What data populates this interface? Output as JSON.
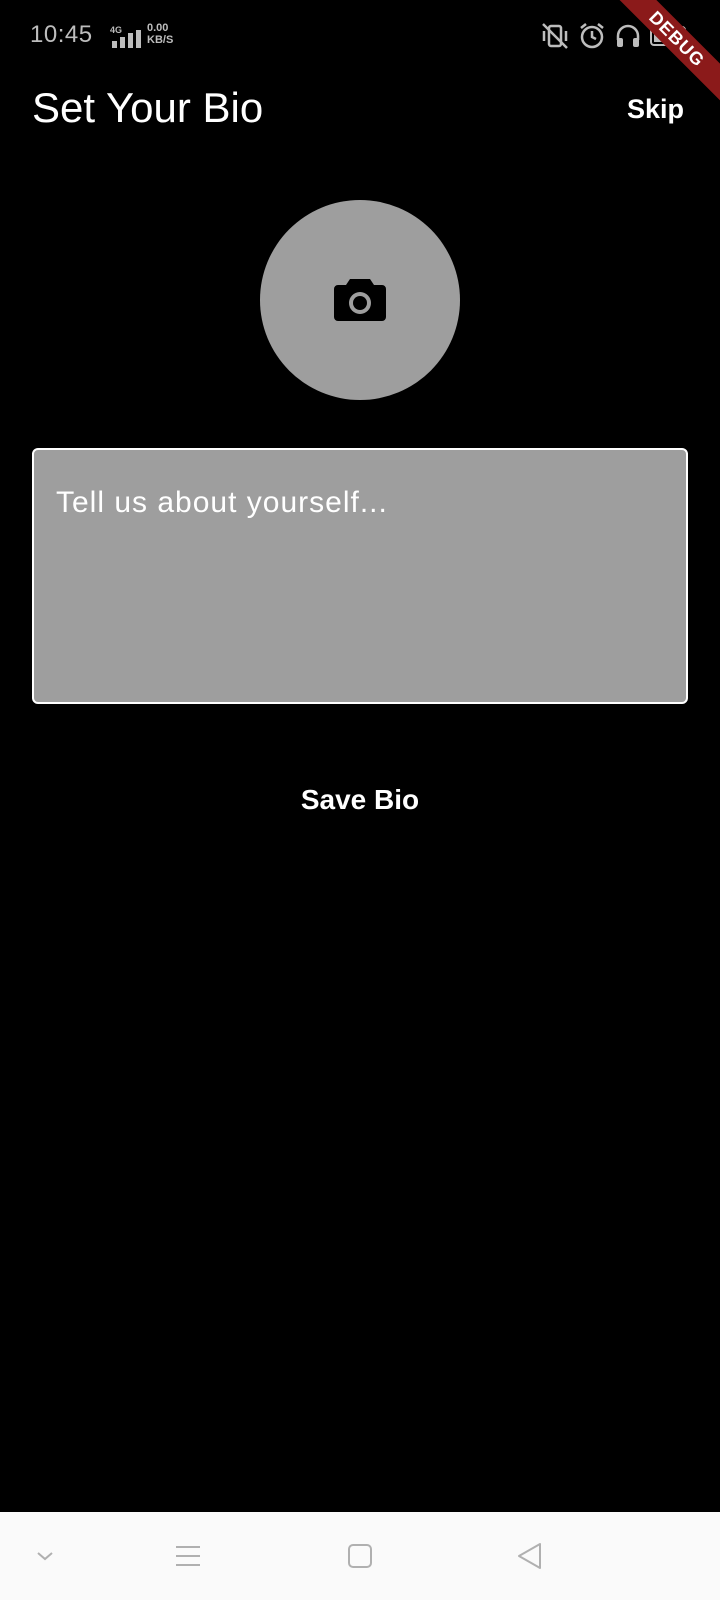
{
  "status_bar": {
    "time": "10:45",
    "network_type": "4G",
    "speed_value": "0.00",
    "speed_unit": "KB/S",
    "icons": [
      "vibrate-off-icon",
      "alarm-icon",
      "headphones-icon",
      "battery-icon"
    ]
  },
  "debug_banner": {
    "label": "DEBUG",
    "color": "#8b1a1a"
  },
  "header": {
    "title": "Set Your Bio",
    "skip_label": "Skip"
  },
  "avatar": {
    "icon": "camera-icon",
    "background": "#9e9e9e"
  },
  "bio": {
    "placeholder": "Tell us about yourself...",
    "value": ""
  },
  "actions": {
    "save_label": "Save Bio"
  },
  "nav_bar": {
    "items": [
      "chevron-down-icon",
      "menu-icon",
      "home-square-icon",
      "back-triangle-icon"
    ]
  },
  "colors": {
    "background": "#000000",
    "field": "#9e9e9e",
    "text": "#ffffff",
    "nav_bg": "#fafafa"
  }
}
